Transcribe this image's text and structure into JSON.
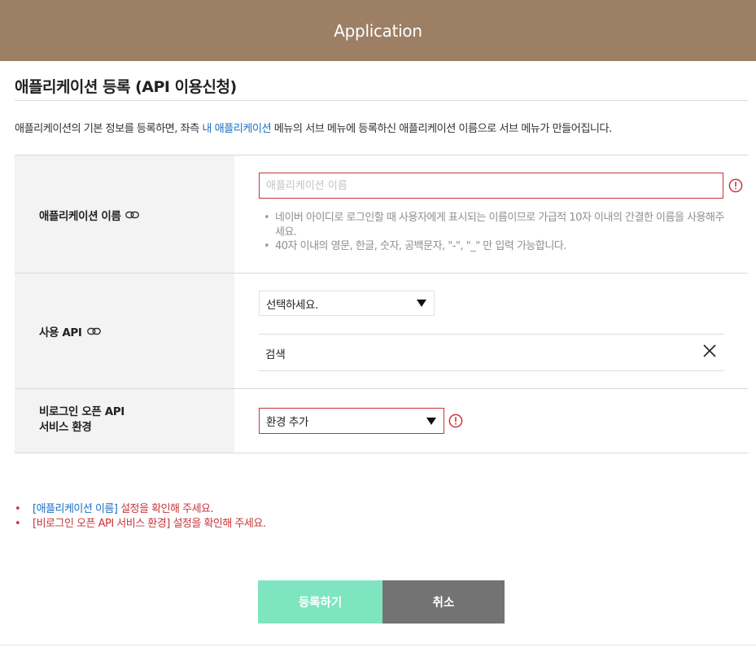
{
  "header": {
    "title": "Application"
  },
  "page": {
    "title": "애플리케이션 등록 (API 이용신청)",
    "description_before": "애플리케이션의 기본 정보를 등록하면, 좌측 ",
    "description_link": "내 애플리케이션",
    "description_after": " 메뉴의 서브 메뉴에 등록하신 애플리케이션 이름으로 서브 메뉴가 만들어집니다."
  },
  "form": {
    "app_name": {
      "label": "애플리케이션 이름",
      "value": "",
      "placeholder": "애플리케이션 이름",
      "hints": [
        "네이버 아이디로 로그인할 때 사용자에게 표시되는 이름이므로 가급적 10자 이내의 간결한 이름을 사용해주세요.",
        "40자 이내의 영문, 한글, 숫자, 공백문자, \"-\", \"_\" 만 입력 가능합니다."
      ]
    },
    "api": {
      "label": "사용 API",
      "select_value": "선택하세요.",
      "selected_items": [
        "검색"
      ]
    },
    "env": {
      "label_line1": "비로그인 오픈 API",
      "label_line2": "서비스 환경",
      "select_value": "환경 추가"
    }
  },
  "errors": [
    {
      "field": "[애플리케이션 이름]",
      "message": " 설정을 확인해 주세요."
    },
    {
      "field": "[비로그인 오픈 API 서비스 환경]",
      "message": " 설정을 확인해 주세요."
    }
  ],
  "buttons": {
    "register": "등록하기",
    "cancel": "취소"
  },
  "colors": {
    "header_bg": "#9c7f65",
    "error": "#c8343a",
    "link": "#1a6fc3",
    "register_button": "#7fe5c1",
    "cancel_button": "#737373",
    "label_cell_bg": "#f3f3f3"
  },
  "icons": {
    "link": "chain-link-icon",
    "alert": "exclamation-circle-icon",
    "remove": "close-x-icon",
    "dropdown": "triangle-down-icon"
  }
}
